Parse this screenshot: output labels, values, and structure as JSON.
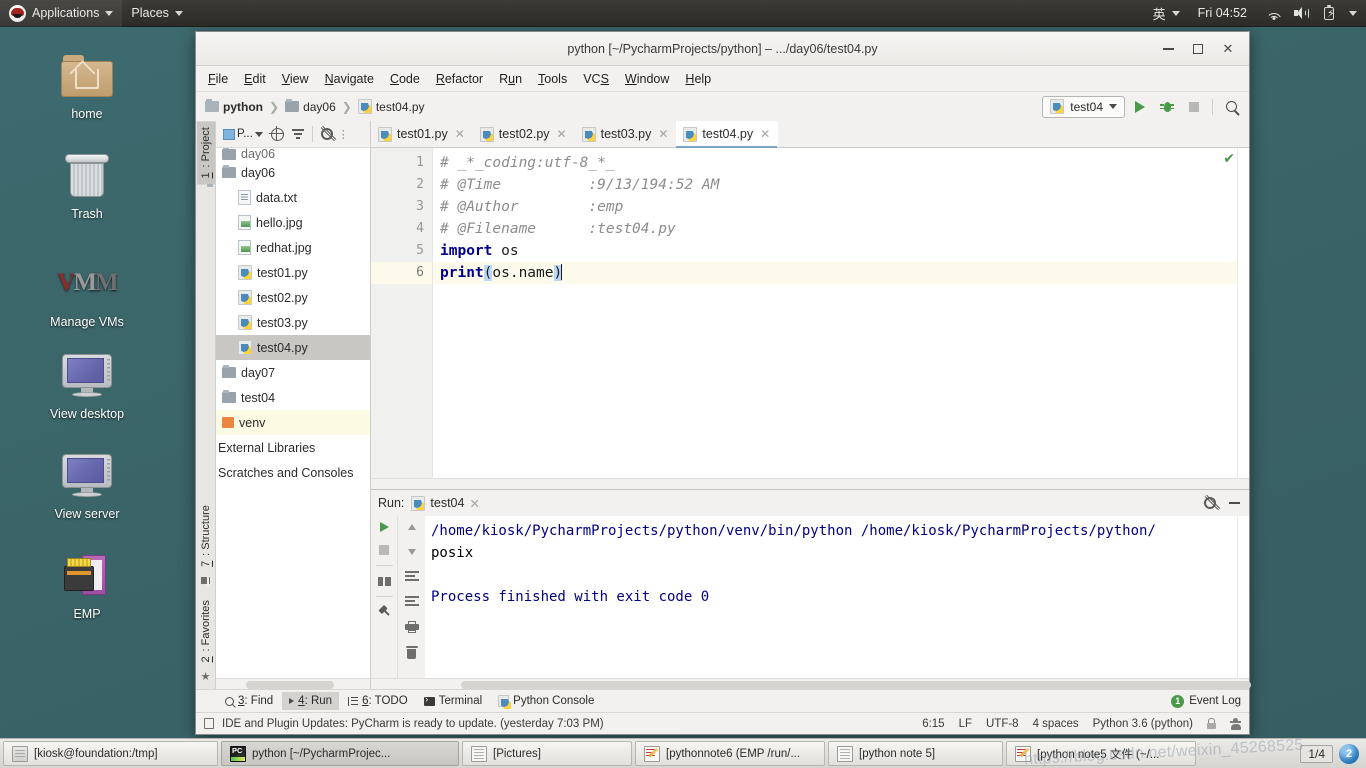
{
  "desktop": {
    "top_panel": {
      "applications": "Applications",
      "places": "Places",
      "input_method": "英",
      "clock": "Fri 04:52",
      "icons": [
        "wifi-icon",
        "volume-icon",
        "battery-icon",
        "chevron-down-icon"
      ]
    },
    "icons": [
      {
        "label": "home",
        "icon": "home-folder-icon"
      },
      {
        "label": "Trash",
        "icon": "trash-icon"
      },
      {
        "label": "Manage VMs",
        "icon": "vmware-icon"
      },
      {
        "label": "View desktop",
        "icon": "monitor-icon"
      },
      {
        "label": "View server",
        "icon": "monitor-icon"
      },
      {
        "label": "EMP",
        "icon": "emp-device-icon"
      }
    ],
    "taskbar": {
      "buttons": [
        {
          "label": "[kiosk@foundation:/tmp]",
          "icon": "terminal-window-icon",
          "active": false
        },
        {
          "label": "python [~/PycharmProjec...",
          "icon": "pycharm-icon",
          "active": true
        },
        {
          "label": "[Pictures]",
          "icon": "file-manager-icon",
          "active": false
        },
        {
          "label": "[pythonnote6 (EMP /run/...",
          "icon": "text-editor-icon",
          "active": false
        },
        {
          "label": "[python note 5]",
          "icon": "file-manager-icon",
          "active": false
        },
        {
          "label": "[python note5 文件 (~/...",
          "icon": "text-editor-icon",
          "active": false
        }
      ],
      "pager": "1/4",
      "workspace_badge": "2"
    },
    "watermark": "https://blog.csdn.net/weixin_45268525"
  },
  "pycharm": {
    "window_title": "python [~/PycharmProjects/python] – .../day06/test04.py",
    "window_buttons": [
      "minimize-button",
      "maximize-button",
      "close-button"
    ],
    "menus": [
      {
        "label": "File",
        "mnemonic": "F"
      },
      {
        "label": "Edit",
        "mnemonic": "E"
      },
      {
        "label": "View",
        "mnemonic": "V"
      },
      {
        "label": "Navigate",
        "mnemonic": "N"
      },
      {
        "label": "Code",
        "mnemonic": "C"
      },
      {
        "label": "Refactor",
        "mnemonic": "R"
      },
      {
        "label": "Run",
        "mnemonic": "u"
      },
      {
        "label": "Tools",
        "mnemonic": "T"
      },
      {
        "label": "VCS",
        "mnemonic": "S"
      },
      {
        "label": "Window",
        "mnemonic": "W"
      },
      {
        "label": "Help",
        "mnemonic": "H"
      }
    ],
    "breadcrumbs": [
      {
        "label": "python",
        "icon": "folder-icon"
      },
      {
        "label": "day06",
        "icon": "folder-icon"
      },
      {
        "label": "test04.py",
        "icon": "python-file-icon"
      }
    ],
    "toolbar": {
      "run_config": "test04",
      "run_config_icon": "python-file-icon",
      "run_button": "run-button",
      "debug_button": "debug-button",
      "stop_button": "stop-button",
      "search_button": "search-everywhere-button"
    },
    "left_strip": {
      "top": [
        {
          "label": "1: Project",
          "mnemonic": "1",
          "active": true
        }
      ],
      "bottom": [
        {
          "label": "7: Structure",
          "mnemonic": "7",
          "active": false
        },
        {
          "label": "2: Favorites",
          "mnemonic": "2",
          "active": false
        }
      ]
    },
    "project_pane": {
      "toolbar_label": "P...",
      "toolbar_icons": [
        "project-view-selector",
        "locate-icon",
        "collapse-all-icon",
        "gear-icon"
      ],
      "tree": [
        {
          "label": "day06",
          "icon": "folder-icon",
          "indent": 0,
          "state": "cut-off"
        },
        {
          "label": "day06",
          "icon": "folder-icon",
          "indent": 0,
          "state": "normal"
        },
        {
          "label": "data.txt",
          "icon": "text-file-icon",
          "indent": 1,
          "state": "normal"
        },
        {
          "label": "hello.jpg",
          "icon": "image-file-icon",
          "indent": 1,
          "state": "normal"
        },
        {
          "label": "redhat.jpg",
          "icon": "image-file-icon",
          "indent": 1,
          "state": "normal"
        },
        {
          "label": "test01.py",
          "icon": "python-file-icon",
          "indent": 1,
          "state": "normal"
        },
        {
          "label": "test02.py",
          "icon": "python-file-icon",
          "indent": 1,
          "state": "normal"
        },
        {
          "label": "test03.py",
          "icon": "python-file-icon",
          "indent": 1,
          "state": "normal"
        },
        {
          "label": "test04.py",
          "icon": "python-file-icon",
          "indent": 1,
          "state": "selected"
        },
        {
          "label": "day07",
          "icon": "folder-icon",
          "indent": 0,
          "state": "normal"
        },
        {
          "label": "test04",
          "icon": "folder-icon",
          "indent": 0,
          "state": "normal"
        },
        {
          "label": "venv",
          "icon": "venv-icon",
          "indent": 0,
          "state": "highlighted"
        },
        {
          "label": "External Libraries",
          "icon": "none",
          "indent": 0,
          "state": "normal"
        },
        {
          "label": "Scratches and Consoles",
          "icon": "none",
          "indent": 0,
          "state": "normal"
        }
      ]
    },
    "editor_tabs": [
      {
        "label": "test01.py",
        "icon": "python-file-icon",
        "active": false
      },
      {
        "label": "test02.py",
        "icon": "python-file-icon",
        "active": false
      },
      {
        "label": "test03.py",
        "icon": "python-file-icon",
        "active": false
      },
      {
        "label": "test04.py",
        "icon": "python-file-icon",
        "active": true
      }
    ],
    "code": {
      "line_numbers": [
        "1",
        "2",
        "3",
        "4",
        "5",
        "6"
      ],
      "lines": [
        "# _*_coding:utf-8_*_",
        "# @Time          :9/13/194:52 AM",
        "# @Author        :emp",
        "# @Filename      :test04.py",
        "import os",
        "print(os.name)"
      ],
      "current_line": 6,
      "inspection_status": "ok-checkmark"
    },
    "run_panel": {
      "label": "Run:",
      "tab": "test04",
      "tab_icon": "python-file-icon",
      "settings_icon": "gear-icon",
      "minimize_icon": "minimize-icon",
      "tool_icons": [
        "rerun-button",
        "stop-button",
        "layout-button",
        "pin-tab-button",
        "scroll-up-button",
        "scroll-down-button",
        "soft-wrap-button",
        "scroll-to-end-button",
        "print-button",
        "clear-all-button"
      ],
      "output": [
        {
          "text": "/home/kiosk/PycharmProjects/python/venv/bin/python /home/kiosk/PycharmProjects/python/",
          "color": "#000080"
        },
        {
          "text": "posix",
          "color": "#000000"
        },
        {
          "text": "",
          "color": "#000000"
        },
        {
          "text": "Process finished with exit code 0",
          "color": "#000080"
        }
      ]
    },
    "tool_window_tabs": [
      {
        "label": "3: Find",
        "mnemonic": "3",
        "icon": "search-icon",
        "active": false
      },
      {
        "label": "4: Run",
        "mnemonic": "4",
        "icon": "run-icon",
        "active": true
      },
      {
        "label": "6: TODO",
        "mnemonic": "6",
        "icon": "list-icon",
        "active": false
      },
      {
        "label": "Terminal",
        "mnemonic": "",
        "icon": "terminal-icon",
        "active": false
      },
      {
        "label": "Python Console",
        "mnemonic": "",
        "icon": "python-icon",
        "active": false
      }
    ],
    "event_log": {
      "label": "Event Log",
      "count": "1"
    },
    "status_bar": {
      "message": "IDE and Plugin Updates: PyCharm is ready to update. (yesterday 7:03 PM)",
      "caret_position": "6:15",
      "line_separator": "LF",
      "encoding": "UTF-8",
      "indent": "4 spaces",
      "interpreter": "Python 3.6 (python)",
      "icons": [
        "notification-icon",
        "lock-icon",
        "user-icon"
      ]
    }
  }
}
